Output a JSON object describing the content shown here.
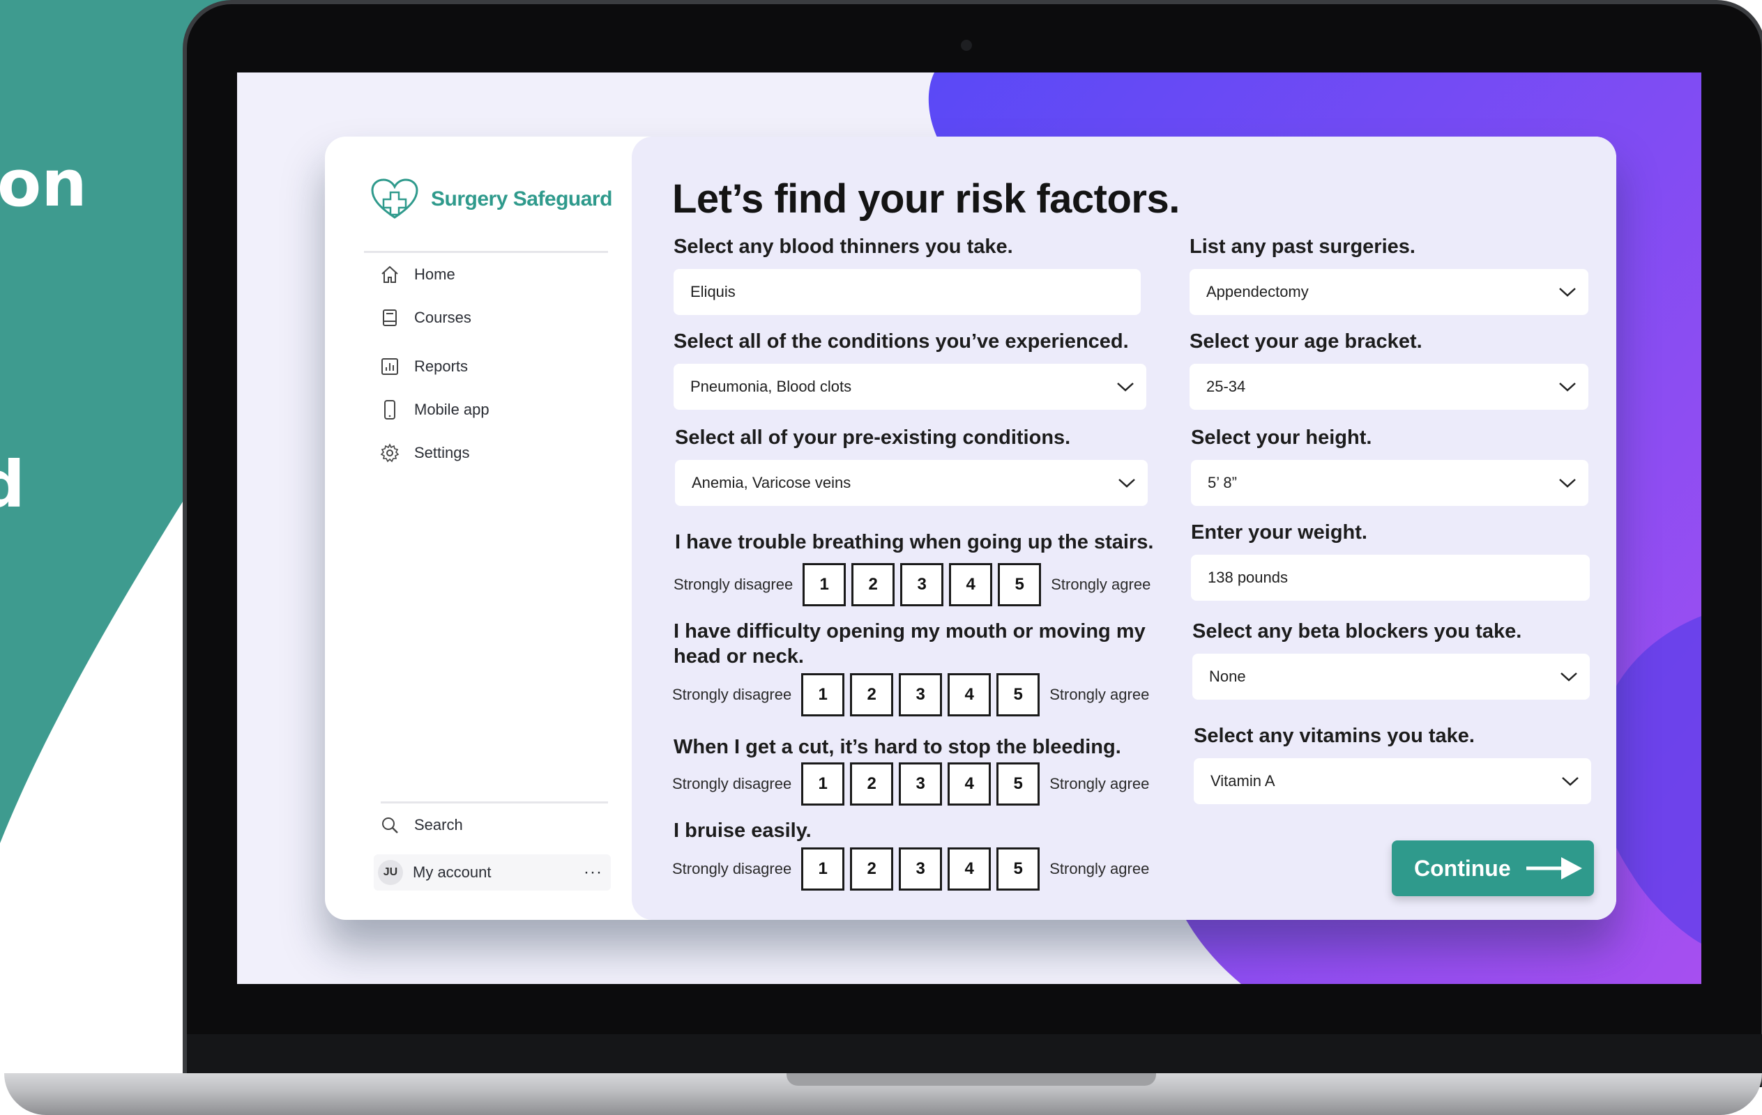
{
  "slide": {
    "text_line1": "on",
    "text_line2": "d"
  },
  "app": {
    "brand": "Surgery Safeguard",
    "nav": [
      {
        "label": "Home",
        "icon": "home-icon"
      },
      {
        "label": "Courses",
        "icon": "book-icon"
      },
      {
        "label": "Reports",
        "icon": "chart-icon"
      },
      {
        "label": "Mobile app",
        "icon": "phone-icon"
      },
      {
        "label": "Settings",
        "icon": "gear-icon"
      }
    ],
    "search_label": "Search",
    "account": {
      "initials": "JU",
      "label": "My account",
      "more": "···"
    }
  },
  "form": {
    "title": "Let’s find your risk factors.",
    "blood_thinners": {
      "label": "Select any blood thinners you take.",
      "value": "Eliquis"
    },
    "conditions": {
      "label": "Select all of the conditions you’ve experienced.",
      "value": "Pneumonia, Blood clots"
    },
    "preexisting": {
      "label": "Select all of your pre-existing conditions.",
      "value": "Anemia, Varicose veins"
    },
    "surgeries": {
      "label": "List any past surgeries.",
      "value": "Appendectomy"
    },
    "age": {
      "label": "Select your age bracket.",
      "value": "25-34"
    },
    "height": {
      "label": "Select your height.",
      "value": "5’ 8”"
    },
    "weight": {
      "label": "Enter your weight.",
      "value": "138 pounds"
    },
    "beta_blockers": {
      "label": "Select any beta blockers you take.",
      "value": "None"
    },
    "vitamins": {
      "label": "Select any vitamins you take.",
      "value": "Vitamin A"
    },
    "scale_low": "Strongly disagree",
    "scale_high": "Strongly agree",
    "scale_values": [
      "1",
      "2",
      "3",
      "4",
      "5"
    ],
    "statements": [
      "I have trouble breathing when going up the stairs.",
      "I have difficulty opening my mouth or moving my head or neck.",
      "When I get a cut, it’s hard to stop the bleeding.",
      "I bruise easily."
    ],
    "continue_label": "Continue"
  },
  "colors": {
    "teal": "#3e9b8f",
    "brand_teal": "#2f9a8c",
    "purple": "#6d4cf5",
    "panel": "#ecebfa"
  }
}
